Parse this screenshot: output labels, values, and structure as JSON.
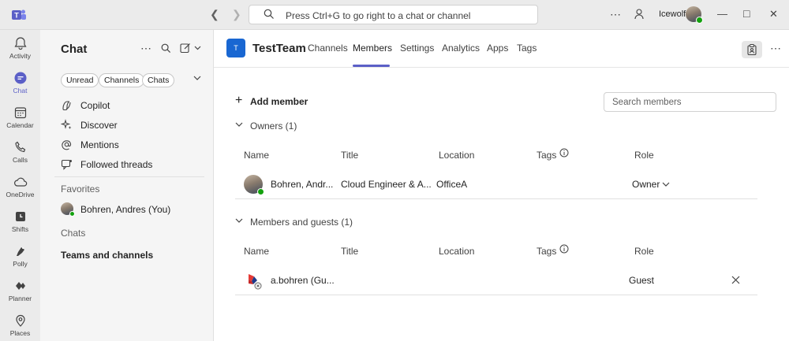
{
  "titlebar": {
    "search_placeholder": "Press Ctrl+G to go right to a chat or channel",
    "username": "Icewolf"
  },
  "rail": {
    "items": [
      {
        "label": "Activity",
        "icon": "bell-icon"
      },
      {
        "label": "Chat",
        "icon": "chat-icon"
      },
      {
        "label": "Calendar",
        "icon": "calendar-icon"
      },
      {
        "label": "Calls",
        "icon": "phone-icon"
      },
      {
        "label": "OneDrive",
        "icon": "cloud-icon"
      },
      {
        "label": "Shifts",
        "icon": "shifts-icon"
      },
      {
        "label": "Polly",
        "icon": "polly-icon"
      },
      {
        "label": "Planner",
        "icon": "planner-icon"
      },
      {
        "label": "Places",
        "icon": "places-icon"
      }
    ]
  },
  "chat": {
    "title": "Chat",
    "filters": [
      "Unread",
      "Channels",
      "Chats"
    ],
    "quick_links": [
      "Copilot",
      "Discover",
      "Mentions",
      "Followed threads"
    ],
    "favorites_label": "Favorites",
    "favorite_user": "Bohren, Andres (You)",
    "chats_label": "Chats",
    "teams_label": "Teams and channels"
  },
  "team": {
    "tile_letter": "T",
    "name": "TestTeam",
    "tabs": [
      "Channels",
      "Members",
      "Settings",
      "Analytics",
      "Apps",
      "Tags"
    ],
    "active_tab": "Members"
  },
  "members": {
    "add_label": "Add member",
    "search_placeholder": "Search members",
    "columns": [
      "Name",
      "Title",
      "Location",
      "Tags",
      "Role"
    ],
    "owners": {
      "label": "Owners (1)",
      "rows": [
        {
          "name": "Bohren, Andr...",
          "title": "Cloud Engineer & A...",
          "location": "OfficeA",
          "role": "Owner"
        }
      ]
    },
    "guests": {
      "label": "Members and guests (1)",
      "rows": [
        {
          "name": "a.bohren (Gu...",
          "title": "",
          "location": "",
          "role": "Guest"
        }
      ]
    }
  },
  "colors": {
    "accent": "#5b5fc7",
    "team_tile": "#1967d2",
    "presence": "#13a10e"
  }
}
